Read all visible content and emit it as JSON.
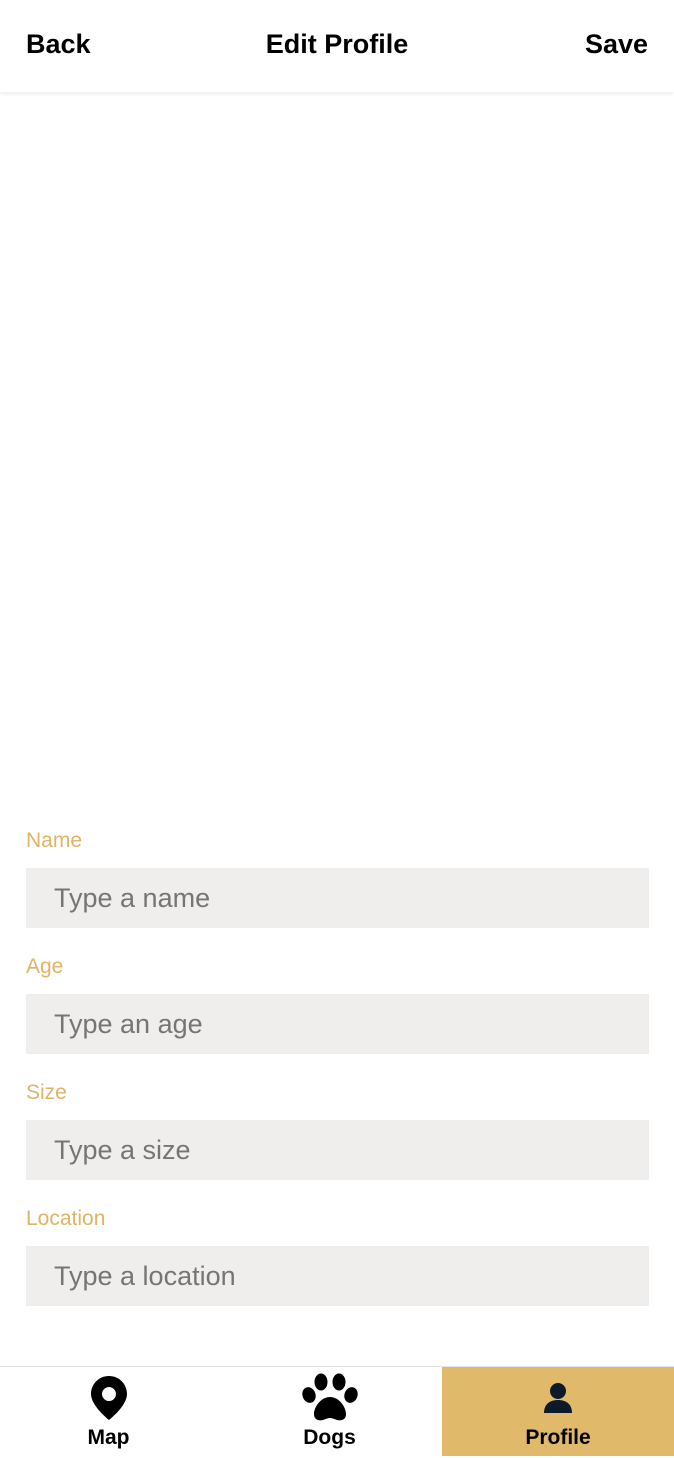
{
  "header": {
    "back_label": "Back",
    "title": "Edit Profile",
    "save_label": "Save"
  },
  "form": {
    "fields": [
      {
        "label": "Name",
        "placeholder": "Type a name",
        "value": ""
      },
      {
        "label": "Age",
        "placeholder": "Type an age",
        "value": ""
      },
      {
        "label": "Size",
        "placeholder": "Type a size",
        "value": ""
      },
      {
        "label": "Location",
        "placeholder": "Type a location",
        "value": ""
      }
    ]
  },
  "tabbar": {
    "tabs": [
      {
        "label": "Map",
        "icon": "map-pin-icon",
        "active": false
      },
      {
        "label": "Dogs",
        "icon": "paw-icon",
        "active": false
      },
      {
        "label": "Profile",
        "icon": "person-icon",
        "active": true
      }
    ]
  },
  "colors": {
    "accent": "#e1b96b",
    "label": "#dfb466",
    "input_bg": "#efeeec"
  }
}
